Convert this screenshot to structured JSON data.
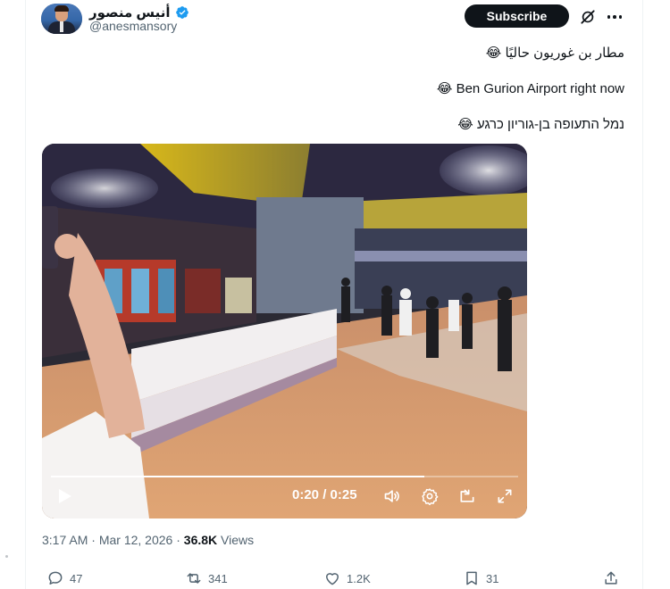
{
  "author": {
    "display_name": "أنيس منصور",
    "handle": "@anesmansory",
    "verified": true
  },
  "header": {
    "subscribe_label": "Subscribe",
    "icons": [
      "grok-icon",
      "more-icon"
    ]
  },
  "tweet": {
    "lines": [
      "مطار بن غوريون حاليًا 😂",
      "😂 Ben Gurion Airport right now",
      "נמל התעופה בן-גוריון כרגע 😂"
    ]
  },
  "video": {
    "current_time": "0:20",
    "duration": "0:25",
    "time_display": "0:20 / 0:25",
    "progress": 0.8
  },
  "meta": {
    "time": "3:17 AM",
    "date": "Mar 12, 2026",
    "views_count": "36.8K",
    "views_label": "Views"
  },
  "actions": {
    "replies": "47",
    "reposts": "341",
    "likes": "1.2K",
    "bookmarks": "31"
  },
  "colors": {
    "text": "#0f1419",
    "secondary": "#536471",
    "verified": "#1d9bf0"
  }
}
